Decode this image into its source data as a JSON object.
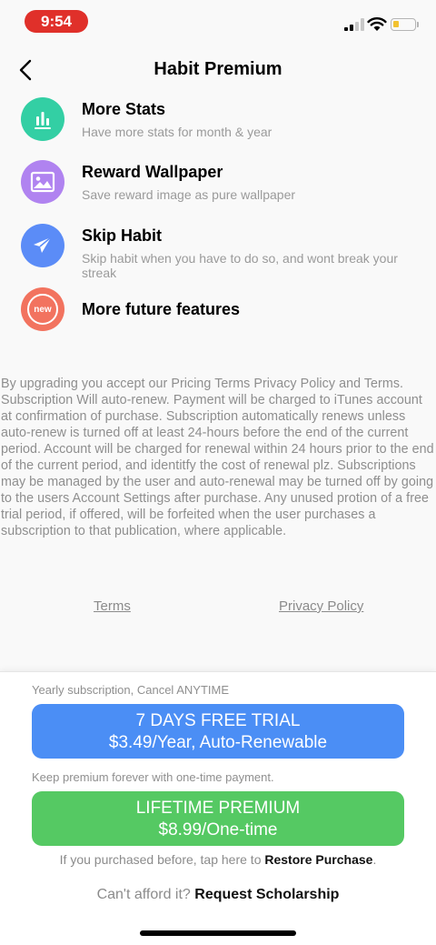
{
  "status": {
    "time": "9:54"
  },
  "nav": {
    "title": "Habit Premium"
  },
  "features": [
    {
      "title": "More Stats",
      "desc": "Have more stats for month & year",
      "icon": "bar-chart-icon",
      "color": "#33cfa4"
    },
    {
      "title": "Reward Wallpaper",
      "desc": "Save reward image as pure wallpaper",
      "icon": "image-icon",
      "color": "#b083f0"
    },
    {
      "title": "Skip Habit",
      "desc": "Skip habit when you have to do so, and wont break your streak",
      "icon": "paper-plane-icon",
      "color": "#5b8cf7"
    },
    {
      "title": "More future features",
      "badge": "new",
      "icon": "new-badge-icon",
      "color": "#f2735f"
    }
  ],
  "legal": {
    "text": "By upgrading you accept our Pricing Terms Privacy Policy and Terms. Subscription Will auto-renew. Payment will be charged to iTunes account at confirmation of purchase. Subscription automatically renews unless auto-renew is turned off at least 24-hours before the end of the current period. Account will be charged for renewal within 24 hours prior to the end of the current period, and identitfy the cost of renewal plz. Subscriptions may be managed by the user and auto-renewal may be turned off by going to the users Account Settings after purchase. Any unused protion of a free trial period, if offered, will be forfeited when the user purchases a subscription to that publication, where applicable."
  },
  "links": {
    "terms": "Terms",
    "privacy": "Privacy Policy"
  },
  "purchase": {
    "yearly_caption": "Yearly subscription, Cancel ANYTIME",
    "trial_line1": "7 DAYS FREE TRIAL",
    "trial_line2": "$3.49/Year, Auto-Renewable",
    "lifetime_caption": "Keep premium forever with one-time payment.",
    "lifetime_line1": "LIFETIME PREMIUM",
    "lifetime_line2": "$8.99/One-time",
    "restore_prefix": "If you purchased before, tap here to",
    "restore_link": "Restore Purchase",
    "restore_suffix": ".",
    "scholar_prefix": "Can't afford it?",
    "scholar_link": "Request Scholarship"
  },
  "colors": {
    "time_pill": "#e0302a",
    "trial_button": "#4b8ef5",
    "lifetime_button": "#55c963"
  }
}
